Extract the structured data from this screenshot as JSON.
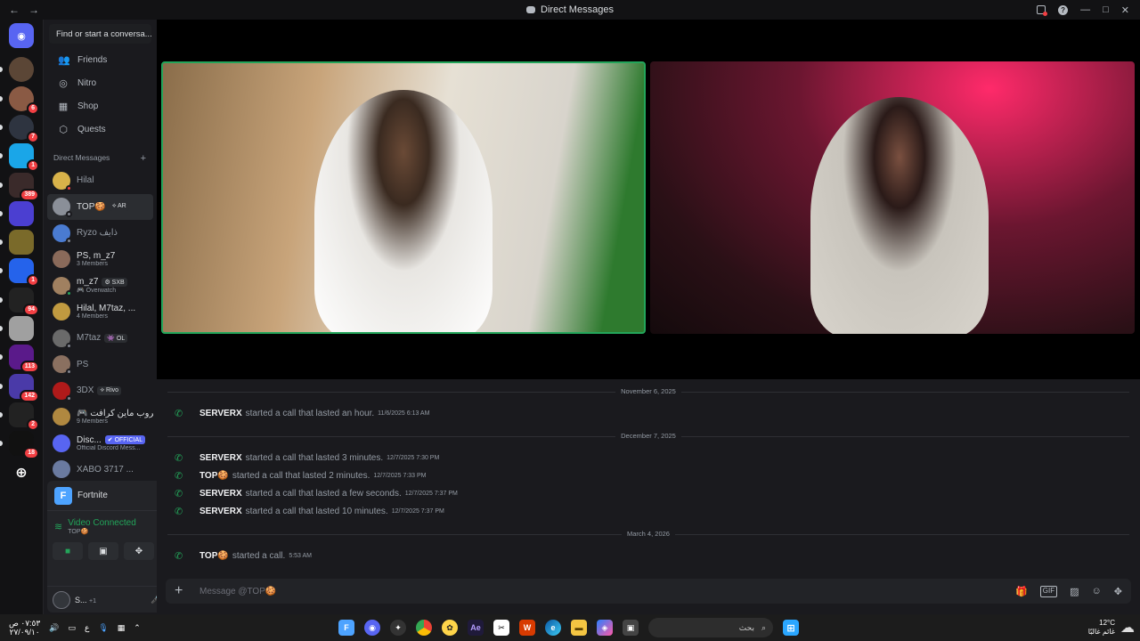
{
  "window": {
    "title": "Direct Messages",
    "nav_back": "←",
    "nav_forward": "→",
    "controls": {
      "minimize": "—",
      "maximize": "□",
      "close": "✕"
    }
  },
  "servers": [
    {
      "id": "home",
      "icon": "discord-logo",
      "color": "#5865f2",
      "badge": ""
    },
    {
      "id": "s1",
      "icon": "avatar",
      "color": "#5b4636",
      "badge": ""
    },
    {
      "id": "s2",
      "icon": "avatar",
      "color": "#8a5a44",
      "badge": "6"
    },
    {
      "id": "s3",
      "icon": "avatar",
      "color": "#2e3440",
      "badge": "7"
    },
    {
      "id": "s4",
      "icon": "server",
      "color": "#1aa6e8",
      "badge": "1"
    },
    {
      "id": "s5",
      "icon": "server",
      "color": "#3a2a2a",
      "badge": "389"
    },
    {
      "id": "s6",
      "icon": "server",
      "color": "#4b3fd1",
      "badge": ""
    },
    {
      "id": "s7",
      "icon": "server",
      "color": "#7a6a2a",
      "badge": ""
    },
    {
      "id": "s8",
      "icon": "server",
      "color": "#2563eb",
      "badge": "1"
    },
    {
      "id": "s9",
      "icon": "server",
      "color": "#222",
      "badge": "94"
    },
    {
      "id": "s10",
      "icon": "server",
      "color": "#a0a0a0",
      "badge": ""
    },
    {
      "id": "s11",
      "icon": "server",
      "color": "#5a1a8a",
      "badge": "113"
    },
    {
      "id": "s12",
      "icon": "server",
      "color": "#4a3aa8",
      "badge": "142"
    },
    {
      "id": "s13",
      "icon": "server",
      "color": "#222",
      "badge": "2"
    },
    {
      "id": "s14",
      "icon": "server",
      "color": "#111",
      "badge": "18"
    }
  ],
  "sidebar": {
    "search_placeholder": "Find or start a conversa...",
    "nav": [
      {
        "label": "Friends",
        "icon": "friends-icon",
        "glyph": "👥"
      },
      {
        "label": "Nitro",
        "icon": "nitro-icon",
        "glyph": "◎"
      },
      {
        "label": "Shop",
        "icon": "shop-icon",
        "glyph": "▦"
      },
      {
        "label": "Quests",
        "icon": "quests-icon",
        "glyph": "⬡"
      }
    ],
    "dm_header": "Direct Messages",
    "dm_add": "+",
    "dms": [
      {
        "name": "Hilal",
        "sub": "",
        "tag": "",
        "color": "#d8b24a",
        "status": "#f23f43",
        "sel": false
      },
      {
        "name": "TOP🍪",
        "sub": "",
        "tag": "⟡ AR",
        "color": "#8a8f98",
        "status": "#80848e",
        "sel": true
      },
      {
        "name": "Ryzo ذايف",
        "sub": "",
        "tag": "",
        "color": "#4a7bd1",
        "status": "#80848e",
        "sel": false
      },
      {
        "name": "PS, m_z7",
        "sub": "3 Members",
        "tag": "",
        "color": "#8a6a5a",
        "status": "",
        "sel": false
      },
      {
        "name": "m_z7",
        "sub": "🎮 Overwatch",
        "tag": "⚙ SXB",
        "color": "#a08060",
        "status": "#23a55a",
        "sel": false
      },
      {
        "name": "Hilal, M7taz, ...",
        "sub": "4 Members",
        "tag": "",
        "color": "#c09a40",
        "status": "",
        "sel": false
      },
      {
        "name": "M7taz",
        "sub": "",
        "tag": "👾 OL",
        "color": "#6a6a6a",
        "status": "#80848e",
        "sel": false
      },
      {
        "name": "PS",
        "sub": "",
        "tag": "",
        "color": "#8a7060",
        "status": "#80848e",
        "sel": false
      },
      {
        "name": "3DX",
        "sub": "",
        "tag": "⟡ Rivo",
        "color": "#b01a1a",
        "status": "#80848e",
        "sel": false
      },
      {
        "name": "🎮 قروب ماين كرافت",
        "sub": "9 Members",
        "tag": "",
        "color": "#b08840",
        "status": "",
        "sel": false
      },
      {
        "name": "Disc...",
        "sub": "Official Discord Mess...",
        "tag": "✔ OFFICIAL",
        "color": "#5865f2",
        "status": "",
        "sel": false
      },
      {
        "name": "XABO 3717 ...",
        "sub": "",
        "tag": "",
        "color": "#6a7aa0",
        "status": "",
        "sel": false
      }
    ]
  },
  "panel": {
    "game": "Fortnite",
    "voice_status": "Video Connected",
    "voice_channel": "TOP🍪",
    "user_name": "S...",
    "user_sub": "+1"
  },
  "messages": {
    "groups": [
      {
        "date": "November 6, 2025",
        "calls": [
          {
            "who": "SERVERX",
            "action": "started a call that lasted an hour.",
            "time": "11/6/2025 6:13 AM"
          }
        ]
      },
      {
        "date": "December 7, 2025",
        "calls": [
          {
            "who": "SERVERX",
            "action": "started a call that lasted 3 minutes.",
            "time": "12/7/2025 7:30 PM"
          },
          {
            "who": "TOP🍪",
            "action": "started a call that lasted 2 minutes.",
            "time": "12/7/2025 7:33 PM"
          },
          {
            "who": "SERVERX",
            "action": "started a call that lasted a few seconds.",
            "time": "12/7/2025 7:37 PM"
          },
          {
            "who": "SERVERX",
            "action": "started a call that lasted 10 minutes.",
            "time": "12/7/2025 7:37 PM"
          }
        ]
      },
      {
        "date": "March 4, 2026",
        "calls": [
          {
            "who": "TOP🍪",
            "action": "started a call.",
            "time": "5:53 AM"
          }
        ]
      }
    ]
  },
  "composer": {
    "placeholder": "Message @TOP🍪"
  },
  "taskbar": {
    "clock_time": "٠٧:٥٣ ص",
    "clock_date": "٢٧/٠٩/١٠",
    "lang": "ع",
    "search_text": "بحث",
    "weather_temp": "12°C",
    "weather_desc": "غائم غالبًا"
  }
}
